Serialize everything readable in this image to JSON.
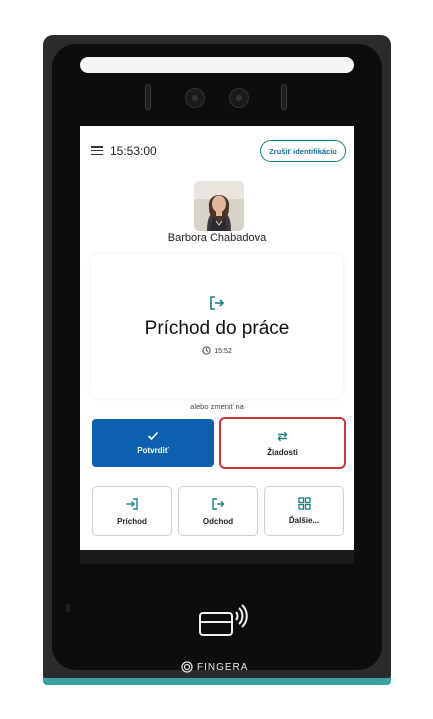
{
  "header": {
    "time": "15:53:00",
    "cancel_label": "Zrušiť identifikáciu"
  },
  "user": {
    "name": "Barbora Chabadova"
  },
  "event": {
    "title": "Príchod do práce",
    "time": "15:52"
  },
  "or_change_label": "alebo zmeniť na",
  "actions": {
    "confirm_label": "Potvrdiť",
    "requests_label": "Žiadosti"
  },
  "quick_actions": [
    {
      "label": "Príchod",
      "icon": "arrow-in-icon"
    },
    {
      "label": "Odchod",
      "icon": "arrow-out-icon"
    },
    {
      "label": "Ďalšie...",
      "icon": "grid-icon"
    }
  ],
  "brand": {
    "name": "FINGERA"
  },
  "colors": {
    "accent": "#0d5fb0",
    "teal": "#1a7f7f",
    "highlight": "#cc3535"
  }
}
